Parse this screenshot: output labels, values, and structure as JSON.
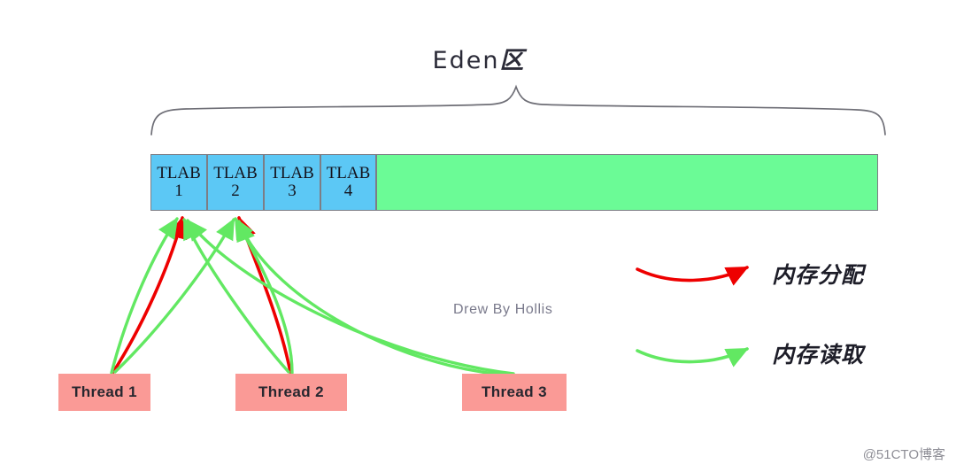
{
  "diagram": {
    "title": "Eden 区",
    "title_latin": "Eden",
    "title_cjk": "区",
    "attribution": "Drew By Hollis",
    "watermark": "@51CTO博客"
  },
  "colors": {
    "tlab_blue": "#5cc8f5",
    "eden_free_green": "#6bfb96",
    "thread_pink": "#fa9a96",
    "allocation_red": "#ee0000",
    "read_green": "#62e862",
    "outline_gray": "#7d7d85",
    "brace_gray": "#6e6e76"
  },
  "memory_bar": {
    "name": "eden-memory-bar",
    "tlabs": [
      {
        "label": "TLAB",
        "number": "1"
      },
      {
        "label": "TLAB",
        "number": "2"
      },
      {
        "label": "TLAB",
        "number": "3"
      },
      {
        "label": "TLAB",
        "number": "4"
      }
    ],
    "free_region_label": ""
  },
  "threads": [
    {
      "label": "Thread 1"
    },
    {
      "label": "Thread 2"
    },
    {
      "label": "Thread 3"
    }
  ],
  "legend": {
    "items": [
      {
        "label": "内存分配",
        "color": "#ee0000",
        "meaning": "memory-allocation"
      },
      {
        "label": "内存读取",
        "color": "#62e862",
        "meaning": "memory-read"
      }
    ]
  }
}
